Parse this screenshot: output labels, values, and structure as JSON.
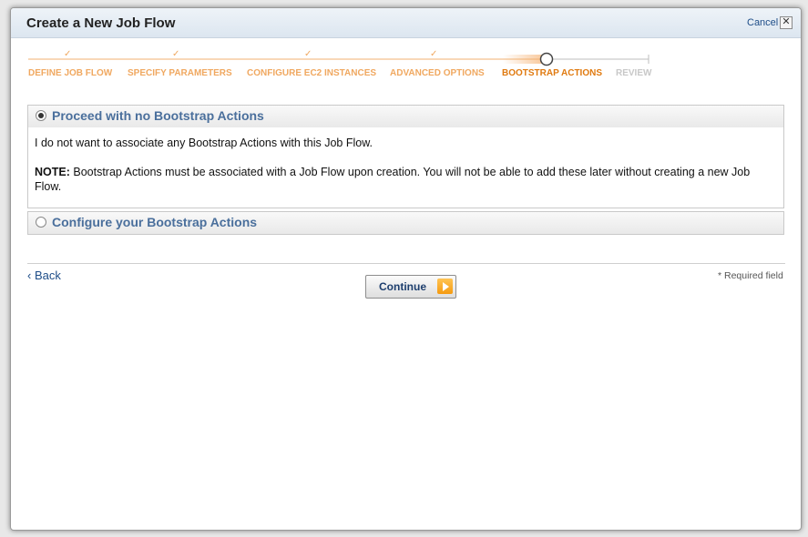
{
  "dialog": {
    "title": "Create a New Job Flow",
    "cancel_label": "Cancel",
    "close_glyph": "✕"
  },
  "progress": {
    "steps": [
      {
        "label": "DEFINE JOB FLOW",
        "state": "done"
      },
      {
        "label": "SPECIFY PARAMETERS",
        "state": "done"
      },
      {
        "label": "CONFIGURE EC2 INSTANCES",
        "state": "done"
      },
      {
        "label": "ADVANCED OPTIONS",
        "state": "done"
      },
      {
        "label": "BOOTSTRAP ACTIONS",
        "state": "current"
      },
      {
        "label": "REVIEW",
        "state": "future"
      }
    ],
    "check_glyph": "✓"
  },
  "options": [
    {
      "label": "Proceed with no Bootstrap Actions",
      "selected": true,
      "body": {
        "line1": "I do not want to associate any Bootstrap Actions with this Job Flow.",
        "note_label": "NOTE:",
        "note_text": " Bootstrap Actions must be associated with a Job Flow upon creation. You will not be able to add these later without creating a new Job Flow."
      }
    },
    {
      "label": "Configure your Bootstrap Actions",
      "selected": false
    }
  ],
  "footer": {
    "back_label": "‹ Back",
    "continue_label": "Continue",
    "required_note": "* Required field"
  },
  "colors": {
    "accent_orange": "#f59a10",
    "link_blue": "#1e4d88",
    "header_blue": "#4a6f9c"
  }
}
